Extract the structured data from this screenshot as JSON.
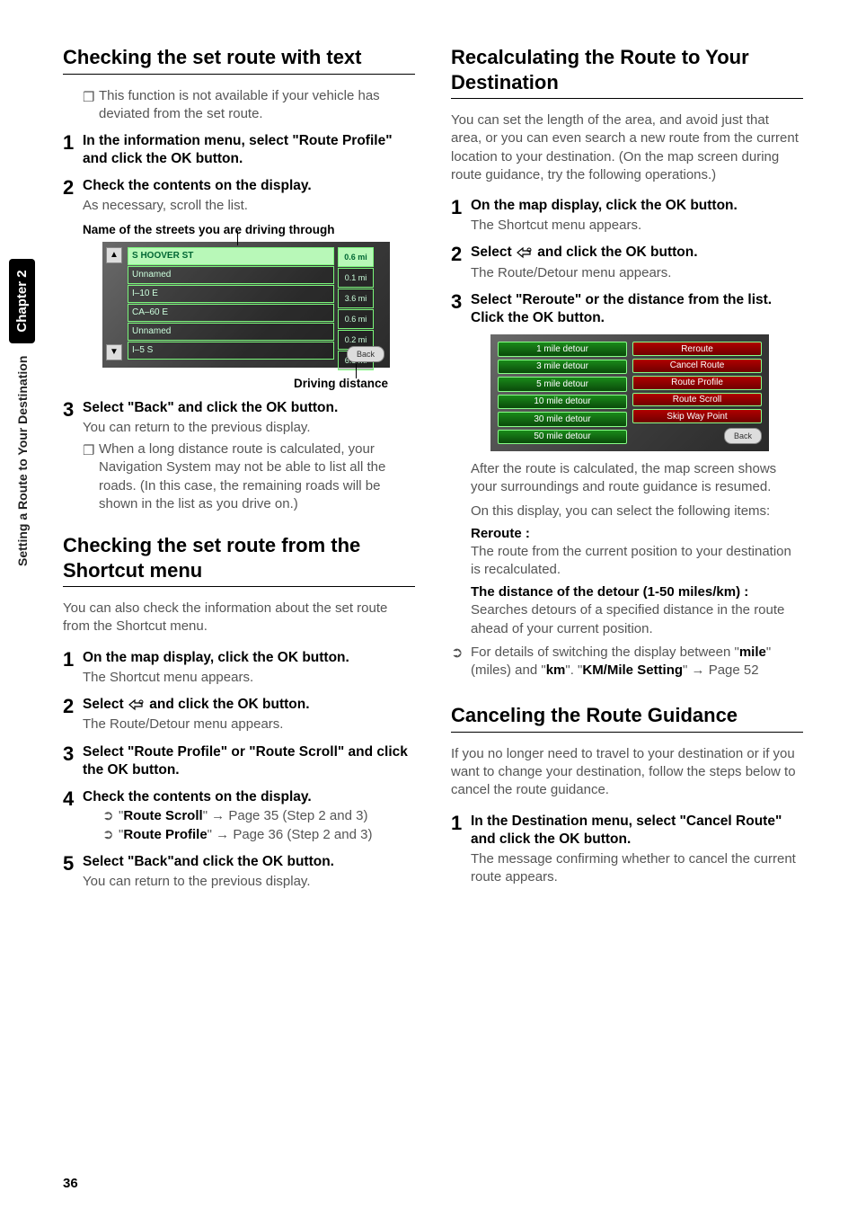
{
  "sidebar": {
    "section_label": "Setting a Route to Your Destination",
    "chapter_label": "Chapter 2"
  },
  "page_number": "36",
  "left": {
    "h1": "Checking the set route with text",
    "note1": "This function is not available if your vehicle has deviated from the set route.",
    "step1": "In the information menu, select \"Route Profile\" and click the OK button.",
    "step2_title": "Check the contents on the display.",
    "step2_sub": "As necessary, scroll the list.",
    "caption_top": "Name of the streets you are driving through",
    "caption_bottom": "Driving distance",
    "shot1_rows": [
      "S HOOVER ST",
      "Unnamed",
      "I–10 E",
      "CA–60 E",
      "Unnamed",
      "I–5 S"
    ],
    "shot1_mi": [
      "0.6  mi",
      "0.1  mi",
      "3.6  mi",
      "0.6  mi",
      "0.2  mi",
      "6.8  mi"
    ],
    "shot1_back": "Back",
    "step3_title": "Select \"Back\" and click the OK button.",
    "step3_sub": "You can return to the previous display.",
    "step3_note": "When a long distance route is calculated, your Navigation System may not be able to list all the roads. (In this case, the remaining roads will be shown in the list as you drive on.)",
    "h2": "Checking the set route from the Shortcut menu",
    "h2_intro": "You can also check the information about the set route from the Shortcut menu.",
    "s2_step1_title": "On the map display, click the OK button.",
    "s2_step1_sub": "The Shortcut menu appears.",
    "s2_step2_a": "Select ",
    "s2_step2_b": " and click the OK button.",
    "s2_step2_sub": "The Route/Detour menu appears.",
    "s2_step3": "Select \"Route Profile\" or \"Route Scroll\" and click the OK button.",
    "s2_step4_title": "Check the contents on the display.",
    "s2_step4_item1_a": "\"",
    "s2_step4_item1_b": "Route Scroll",
    "s2_step4_item1_c": "\" → Page 35 (Step 2 and 3)",
    "s2_step4_item2_a": "\"",
    "s2_step4_item2_b": "Route Profile",
    "s2_step4_item2_c": "\" → Page 36 (Step 2 and 3)",
    "s2_step5_title": "Select \"Back\"and click the OK button.",
    "s2_step5_sub": "You can return to the previous display."
  },
  "right": {
    "h1": "Recalculating the Route to Your Destination",
    "intro": "You can set the length of the area, and avoid just that area, or you can even search a new route from the current location to your destination. (On the map screen during route guidance, try the following operations.)",
    "step1_title": "On the map display, click the OK button.",
    "step1_sub": "The Shortcut menu appears.",
    "step2_a": "Select ",
    "step2_b": " and click the OK button.",
    "step2_sub": "The Route/Detour menu appears.",
    "step3_title": "Select \"Reroute\" or the distance from the list. Click the OK button.",
    "shot2_left": [
      "1 mile detour",
      "3 mile detour",
      "5 mile detour",
      "10 mile detour",
      "30 mile detour",
      "50 mile detour"
    ],
    "shot2_right": [
      "Reroute",
      "Cancel Route",
      "Route Profile",
      "Route Scroll",
      "Skip Way Point"
    ],
    "shot2_back": "Back",
    "after1": "After the route is calculated, the map screen shows your surroundings and route guidance is resumed.",
    "after2": "On this display, you can select the following items:",
    "reroute_label": "Reroute :",
    "reroute_body": "The route from the current position to your destination is recalculated.",
    "detour_label": "The distance of the detour (1-50 miles/km) :",
    "detour_body": "Searches detours of a specified distance in the route ahead of your current position.",
    "ref_a": "For details of switching the display between \"",
    "ref_b": "mile",
    "ref_c": "\" (miles) and \"",
    "ref_d": "km",
    "ref_e": "\". \"",
    "ref_f": "KM/Mile Setting",
    "ref_g": "\" → Page 52",
    "h2": "Canceling the Route Guidance",
    "h2_intro": "If you no longer need to travel to your destination or if you want to change your destination, follow the steps below to cancel the route guidance.",
    "c_step1_title": "In the Destination menu, select \"Cancel Route\" and click the OK button.",
    "c_step1_sub": "The message confirming whether to cancel the current route appears."
  }
}
